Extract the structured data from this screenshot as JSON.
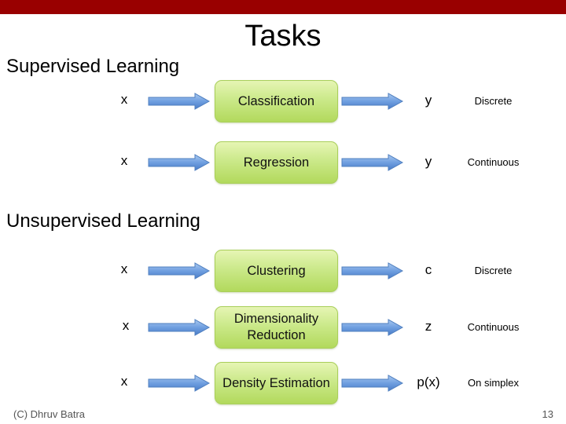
{
  "slide": {
    "title": "Tasks",
    "footer_author": "(C) Dhruv Batra",
    "page_number": "13",
    "accent_color": "#990000"
  },
  "sections": {
    "supervised": {
      "heading": "Supervised Learning",
      "rows": [
        {
          "input": "x",
          "task": "Classification",
          "output": "y",
          "output_type": "Discrete"
        },
        {
          "input": "x",
          "task": "Regression",
          "output": "y",
          "output_type": "Continuous"
        }
      ]
    },
    "unsupervised": {
      "heading": "Unsupervised Learning",
      "rows": [
        {
          "input": "x",
          "task": "Clustering",
          "output": "c",
          "output_type": "Discrete"
        },
        {
          "input": "x",
          "task": "Dimensionality Reduction",
          "output": "z",
          "output_type": "Continuous"
        },
        {
          "input": "x",
          "task": "Density Estimation",
          "output": "p(x)",
          "output_type": "On simplex"
        }
      ]
    }
  },
  "icons": {
    "arrow": "right-arrow-icon"
  }
}
